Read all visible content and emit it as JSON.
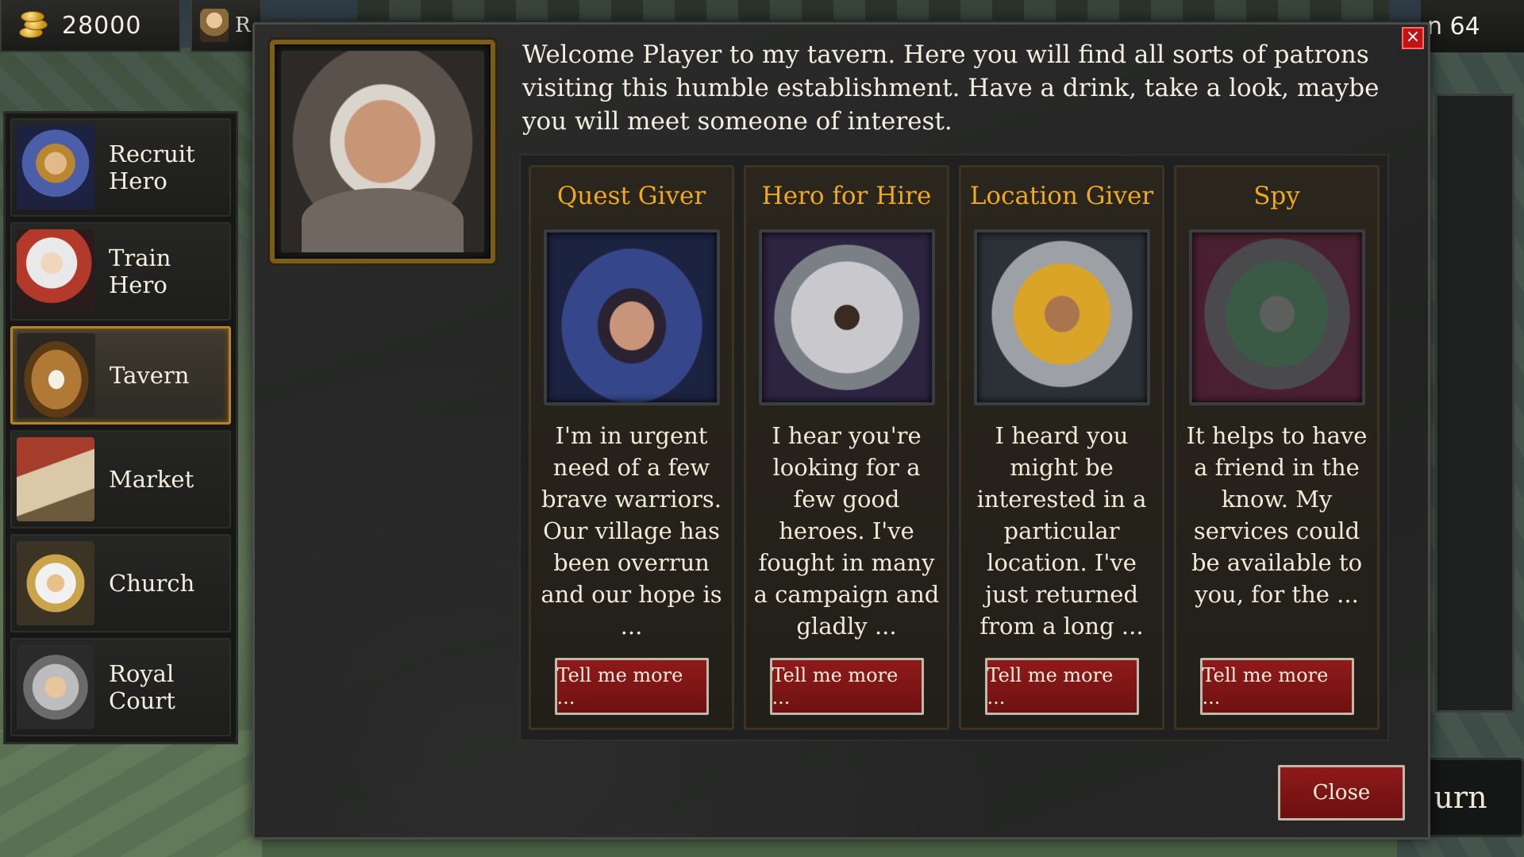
{
  "topbar": {
    "gold": "28000",
    "hero_letter": "R",
    "turn_fragment": "n 64",
    "end_turn_fragment": "urn"
  },
  "nav": {
    "items": [
      {
        "label": "Recruit Hero",
        "icon": "recruit-hero-portrait"
      },
      {
        "label": "Train Hero",
        "icon": "train-hero-portrait"
      },
      {
        "label": "Tavern",
        "icon": "tavern-mug-portrait",
        "active": true
      },
      {
        "label": "Market",
        "icon": "market-building-portrait"
      },
      {
        "label": "Church",
        "icon": "church-bishop-portrait"
      },
      {
        "label": "Royal Court",
        "icon": "royal-court-knight-portrait"
      }
    ]
  },
  "dialog": {
    "close_x": "×",
    "welcome": "Welcome Player to my tavern. Here you will find all sorts of patrons visiting this humble establishment. Have a drink, take a look, maybe you will meet someone of interest.",
    "close_button": "Close",
    "patrons": [
      {
        "title": "Quest Giver",
        "portrait": "hooded-woman-portrait",
        "text": "I'm in urgent need of a few brave warriors. Our village has been overrun and our hope is ...",
        "button": "Tell me more ..."
      },
      {
        "title": "Hero for Hire",
        "portrait": "armored-knight-portrait",
        "text": "I hear you're looking for a few good heroes. I've fought in many a campaign and gladly ...",
        "button": "Tell me more ..."
      },
      {
        "title": "Location Giver",
        "portrait": "turbaned-warrior-portrait",
        "text": "I heard you might be interested in a particular location. I've just returned from a long ...",
        "button": "Tell me more ..."
      },
      {
        "title": "Spy",
        "portrait": "masked-spy-portrait",
        "text": "It helps to have a friend in the know. My services could be available to you, for the ...",
        "button": "Tell me more ..."
      }
    ]
  },
  "colors": {
    "accent_gold": "#f0a81e",
    "button_red": "#8f1a1a",
    "active_border": "#b5832a"
  }
}
